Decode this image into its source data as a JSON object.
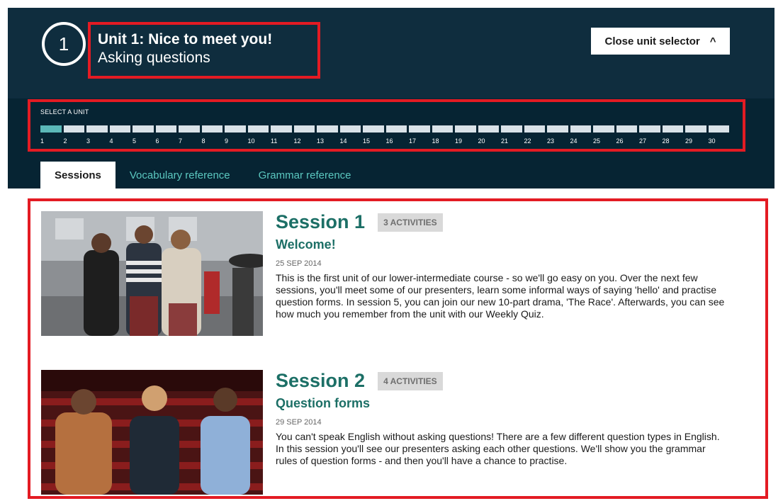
{
  "header": {
    "unit_number": "1",
    "title": "Unit 1: Nice to meet you!",
    "subtitle": "Asking questions",
    "close_label": "Close unit selector",
    "close_icon": "chevron-up-icon"
  },
  "selector": {
    "label": "SELECT A UNIT",
    "active_unit": 1,
    "units": [
      "1",
      "2",
      "3",
      "4",
      "5",
      "6",
      "7",
      "8",
      "9",
      "10",
      "11",
      "12",
      "13",
      "14",
      "15",
      "16",
      "17",
      "18",
      "19",
      "20",
      "21",
      "22",
      "23",
      "24",
      "25",
      "26",
      "27",
      "28",
      "29",
      "30"
    ]
  },
  "tabs": [
    {
      "label": "Sessions",
      "active": true
    },
    {
      "label": "Vocabulary reference",
      "active": false
    },
    {
      "label": "Grammar reference",
      "active": false
    }
  ],
  "sessions": [
    {
      "title": "Session 1",
      "badge": "3 ACTIVITIES",
      "subtitle": "Welcome!",
      "date": "25 SEP 2014",
      "description": "This is the first unit of our lower-intermediate course - so we'll go easy on you. Over the next few sessions, you'll meet some of our presenters, learn some informal ways of saying 'hello' and practise question forms. In session 5, you can join our new 10-part drama, 'The Race'. Afterwards, you can see how much you remember from the unit with our Weekly Quiz."
    },
    {
      "title": "Session 2",
      "badge": "4 ACTIVITIES",
      "subtitle": "Question forms",
      "date": "29 SEP 2014",
      "description": "You can't speak English without asking questions! There are a few different question types in English. In this session you'll see our presenters asking each other questions. We'll show you the grammar rules of question forms - and then you'll have a chance to practise."
    }
  ],
  "colors": {
    "header_bg": "#0f2d3e",
    "band_bg": "#062433",
    "accent_teal": "#1c6f66",
    "tab_link": "#5bc8c0",
    "highlight_red": "#e31b23"
  }
}
